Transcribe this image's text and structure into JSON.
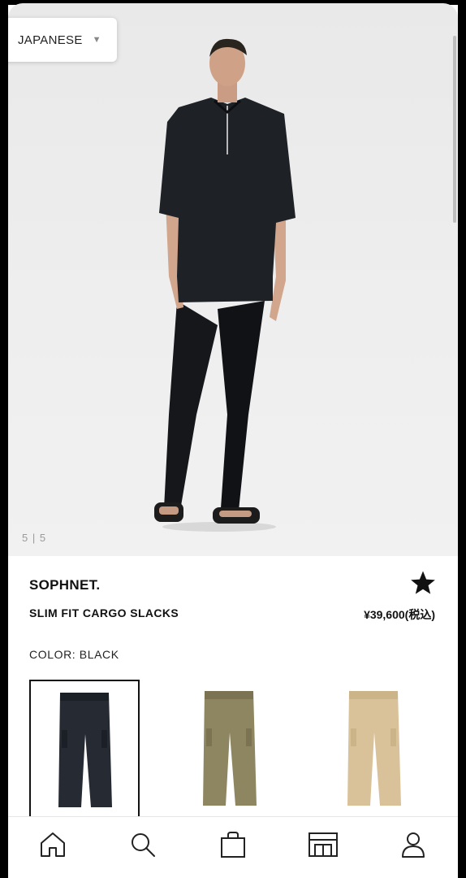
{
  "language_selector": {
    "label": "JAPANESE",
    "arrow_icon": "triangle-down-icon"
  },
  "gallery": {
    "counter": "5 | 5"
  },
  "product": {
    "brand": "SOPHNET.",
    "name": "SLIM FIT CARGO SLACKS",
    "price": "¥39,600(税込)",
    "favorite_icon": "star-icon"
  },
  "color": {
    "label": "COLOR: BLACK",
    "swatches": [
      {
        "name": "black",
        "hex": "#262b33",
        "selected": true
      },
      {
        "name": "olive",
        "hex": "#8e8561",
        "selected": false
      },
      {
        "name": "beige",
        "hex": "#d9c29a",
        "selected": false
      }
    ]
  },
  "nav": {
    "items": [
      "home-icon",
      "search-icon",
      "bag-icon",
      "store-icon",
      "account-icon"
    ]
  }
}
